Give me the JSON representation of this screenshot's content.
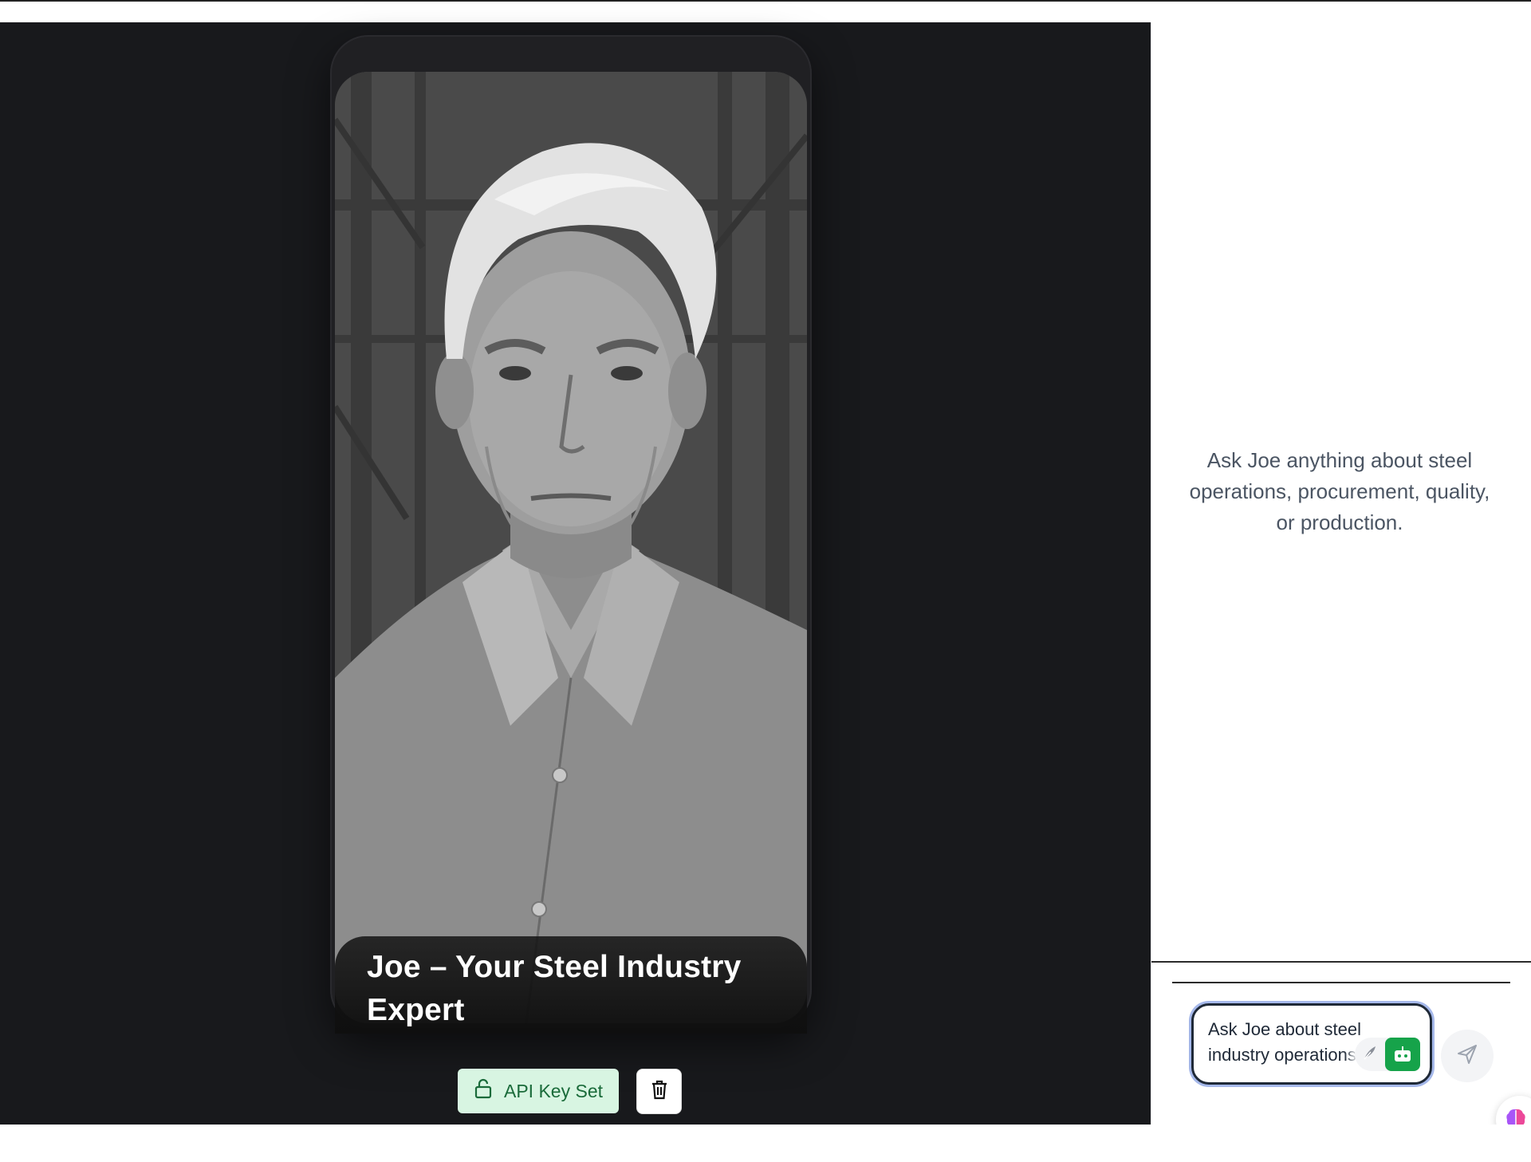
{
  "portrait": {
    "alt": "Joe – Your Steel Industry Expert"
  },
  "caption": {
    "title": "Joe – Your Steel Industry Expert"
  },
  "controls": {
    "api_key_label": "API Key Set",
    "api_icon": "lock-icon",
    "delete_icon": "trash-icon"
  },
  "chat": {
    "empty_hint": "Ask Joe anything about steel operations, procurement, quality, or production.",
    "input_placeholder": "Ask Joe about steel industry operations...",
    "input_visible_text": "Ask Joe about steel industry operations",
    "send_icon": "send-icon",
    "assist_icons": [
      "feather-icon",
      "bot-icon"
    ],
    "brain_icon": "brain-icon"
  },
  "colors": {
    "stage_bg": "#18191c",
    "api_bg": "#d8f5e2",
    "api_text": "#1a6b3a",
    "bot_green": "#16a34a",
    "focus_ring": "#a5b8ea"
  }
}
